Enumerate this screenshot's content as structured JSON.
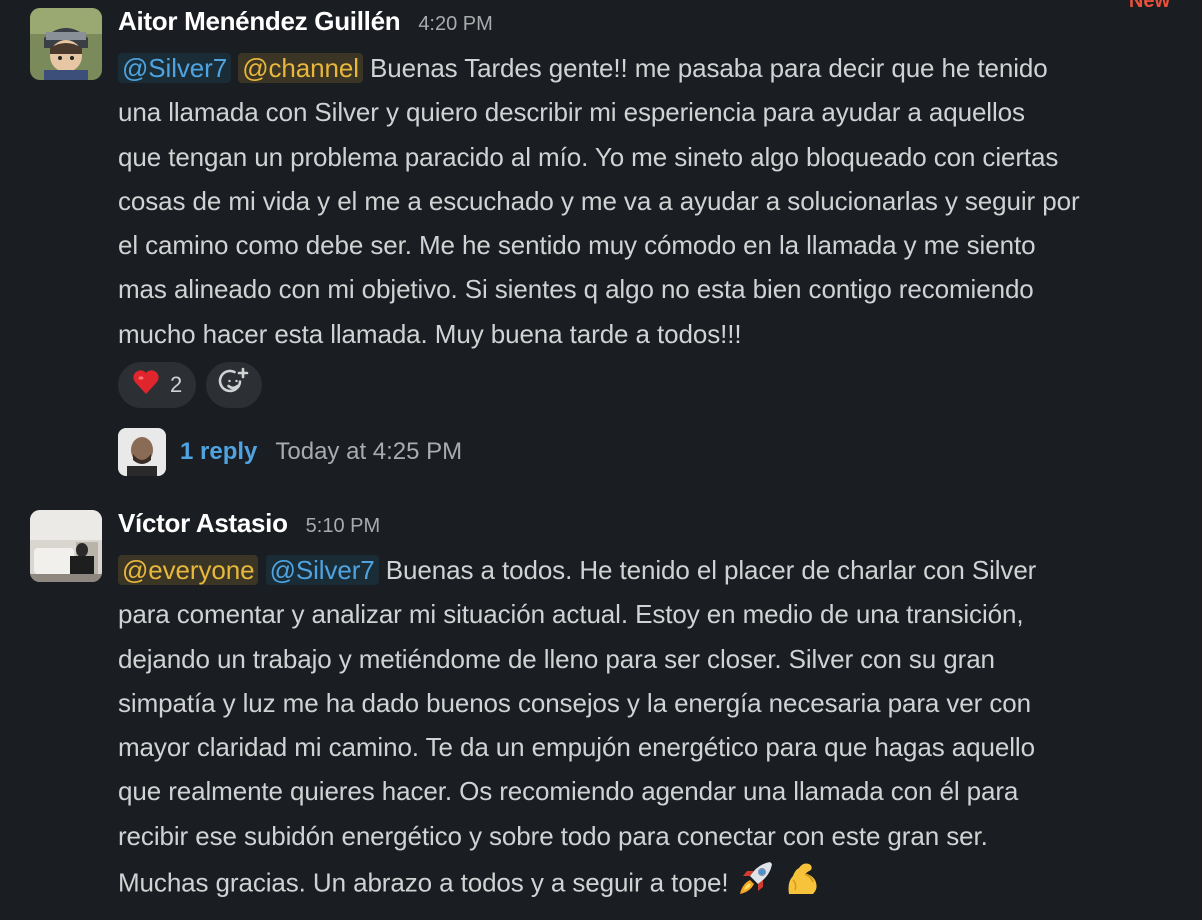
{
  "new_marker": "New",
  "messages": [
    {
      "author": "Aitor Menéndez Guillén",
      "time": "4:20 PM",
      "mentions": [
        "@Silver7",
        "@channel"
      ],
      "lines": [
        "Buenas Tardes gente!! me pasaba para decir que he tenido",
        "una llamada con Silver y quiero describir mi esperiencia para ayudar a aquellos",
        "que tengan un problema paracido al mío. Yo me sineto algo bloqueado con ciertas",
        "cosas de mi vida y el me a escuchado y me va a ayudar a solucionarlas y seguir por",
        "el camino como debe ser. Me he sentido muy cómodo en la llamada y me siento",
        "mas alineado con mi objetivo. Si sientes q algo no esta bien contigo recomiendo",
        "mucho hacer esta llamada.  Muy buena tarde a todos!!!"
      ],
      "reactions": [
        {
          "emoji": "heart-emoji",
          "count": "2"
        },
        {
          "emoji": "add-reaction-icon",
          "count": ""
        }
      ],
      "thread": {
        "replies": "1 reply",
        "last_reply": "Today at 4:25 PM"
      }
    },
    {
      "author": "Víctor Astasio",
      "time": "5:10 PM",
      "mentions": [
        "@everyone",
        "@Silver7"
      ],
      "lines": [
        "Buenas a todos. He tenido el placer de charlar con Silver",
        "para comentar y analizar mi situación actual. Estoy en medio de una transición,",
        "dejando un trabajo y metiéndome de lleno para ser closer. Silver con su gran",
        "simpatía y luz me ha dado buenos consejos y la energía necesaria para ver con",
        "mayor claridad mi camino. Te da un empujón energético para que hagas aquello",
        "que realmente quieres hacer. Os recomiendo agendar una llamada con él para",
        "recibir ese subidón energético y sobre todo para conectar con este gran ser.",
        "Muchas gracias. Un abrazo a todos y a seguir a tope!"
      ],
      "trailing_emojis": [
        "rocket-emoji",
        "flexed-biceps-emoji"
      ]
    }
  ],
  "colors": {
    "background": "#1a1d21",
    "text": "#d1d2d3",
    "mention_blue": "#4fa3e0",
    "mention_yellow": "#e8b73c",
    "new_marker": "#e8503a"
  }
}
